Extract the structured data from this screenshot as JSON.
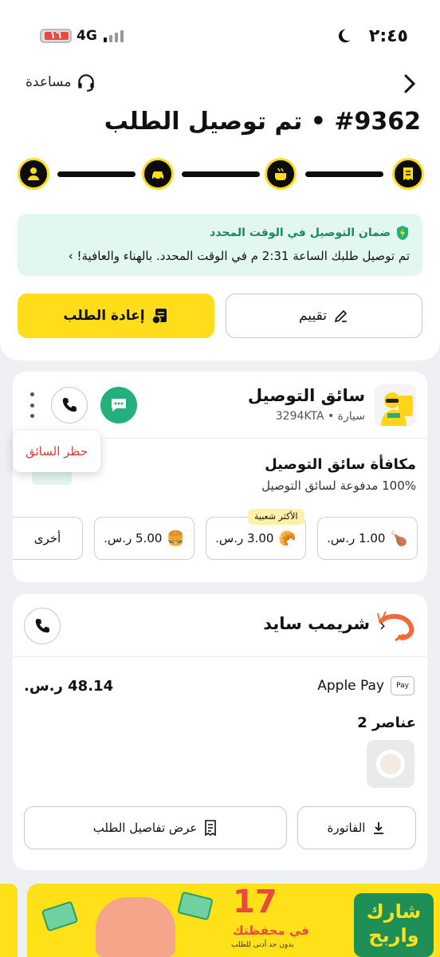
{
  "status_bar": {
    "time": "٢:٤٥",
    "battery": "١٦",
    "network": "4G"
  },
  "header": {
    "help_label": "مساعدة",
    "title": "#9362 • تم توصيل الطلب"
  },
  "progress": {
    "steps": [
      "receipt-icon",
      "cooking-pot-icon",
      "car-icon",
      "person-icon"
    ],
    "completed": 4
  },
  "guarantee": {
    "title": "ضمان التوصيل في الوقت المحدد",
    "body": "تم توصيل طلبك الساعة 2:31 م في الوقت المحدد. بالهناء والعافية! ›"
  },
  "actions": {
    "rate_label": "تقييم",
    "reorder_label": "إعادة الطلب"
  },
  "driver": {
    "title": "سائق التوصيل",
    "subtitle": "سيارة • 3294KTA",
    "block_label": "حظر السائق",
    "tip_title": "مكافأة سائق التوصيل",
    "tip_subtitle": "100% مدفوعة لسائق التوصيل",
    "popular_badge": "الأكثر شعبية",
    "tips": [
      {
        "emoji": "🍗",
        "label": "1.00 ر.س."
      },
      {
        "emoji": "🥐",
        "label": "3.00 ر.س."
      },
      {
        "emoji": "🍔",
        "label": "5.00 ر.س."
      },
      {
        "emoji": "",
        "label": "أخرى"
      }
    ]
  },
  "restaurant": {
    "name": "شريمب سايد",
    "payment_method": "Apple Pay",
    "payment_badge": "Pay",
    "amount": "48.14 ر.س.",
    "items_count": "عناصر 2",
    "invoice_label": "الفاتورة",
    "details_label": "عرض تفاصيل الطلب"
  },
  "promo": {
    "amount": "17",
    "wallet_text": "في محفظتك",
    "min_text": "بدون حد أدنى للطلب",
    "brand_text": "شارك واربح"
  },
  "colors": {
    "accent": "#ffdd1a",
    "success": "#23b07d",
    "danger": "#d63b36"
  }
}
